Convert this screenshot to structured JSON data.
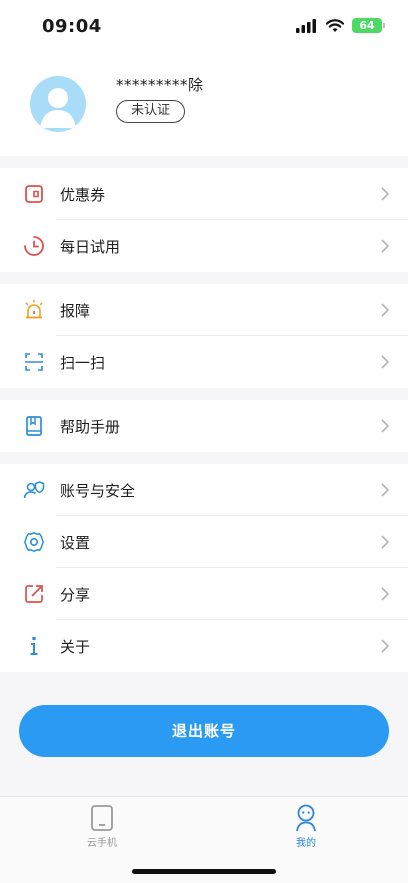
{
  "status_bar": {
    "time": "09:04",
    "battery": "64"
  },
  "profile": {
    "username": "*********除",
    "verify_badge": "未认证"
  },
  "menu": {
    "group1": [
      {
        "label": "优惠券",
        "icon": "coupon-icon"
      },
      {
        "label": "每日试用",
        "icon": "clock-icon"
      }
    ],
    "group2": [
      {
        "label": "报障",
        "icon": "alarm-icon"
      },
      {
        "label": "扫一扫",
        "icon": "scan-icon"
      }
    ],
    "group3": [
      {
        "label": "帮助手册",
        "icon": "book-icon"
      }
    ],
    "group4": [
      {
        "label": "账号与安全",
        "icon": "user-shield-icon"
      },
      {
        "label": "设置",
        "icon": "gear-icon"
      },
      {
        "label": "分享",
        "icon": "share-icon"
      },
      {
        "label": "关于",
        "icon": "info-icon"
      }
    ]
  },
  "logout_label": "退出账号",
  "tabbar": {
    "phone_label": "云手机",
    "mine_label": "我的"
  },
  "colors": {
    "accent": "#2b9af3",
    "tab_active": "#2b86d9",
    "red_icon": "#e0504b",
    "orange_icon": "#f0a020",
    "blue_icon": "#2b8fd6"
  }
}
